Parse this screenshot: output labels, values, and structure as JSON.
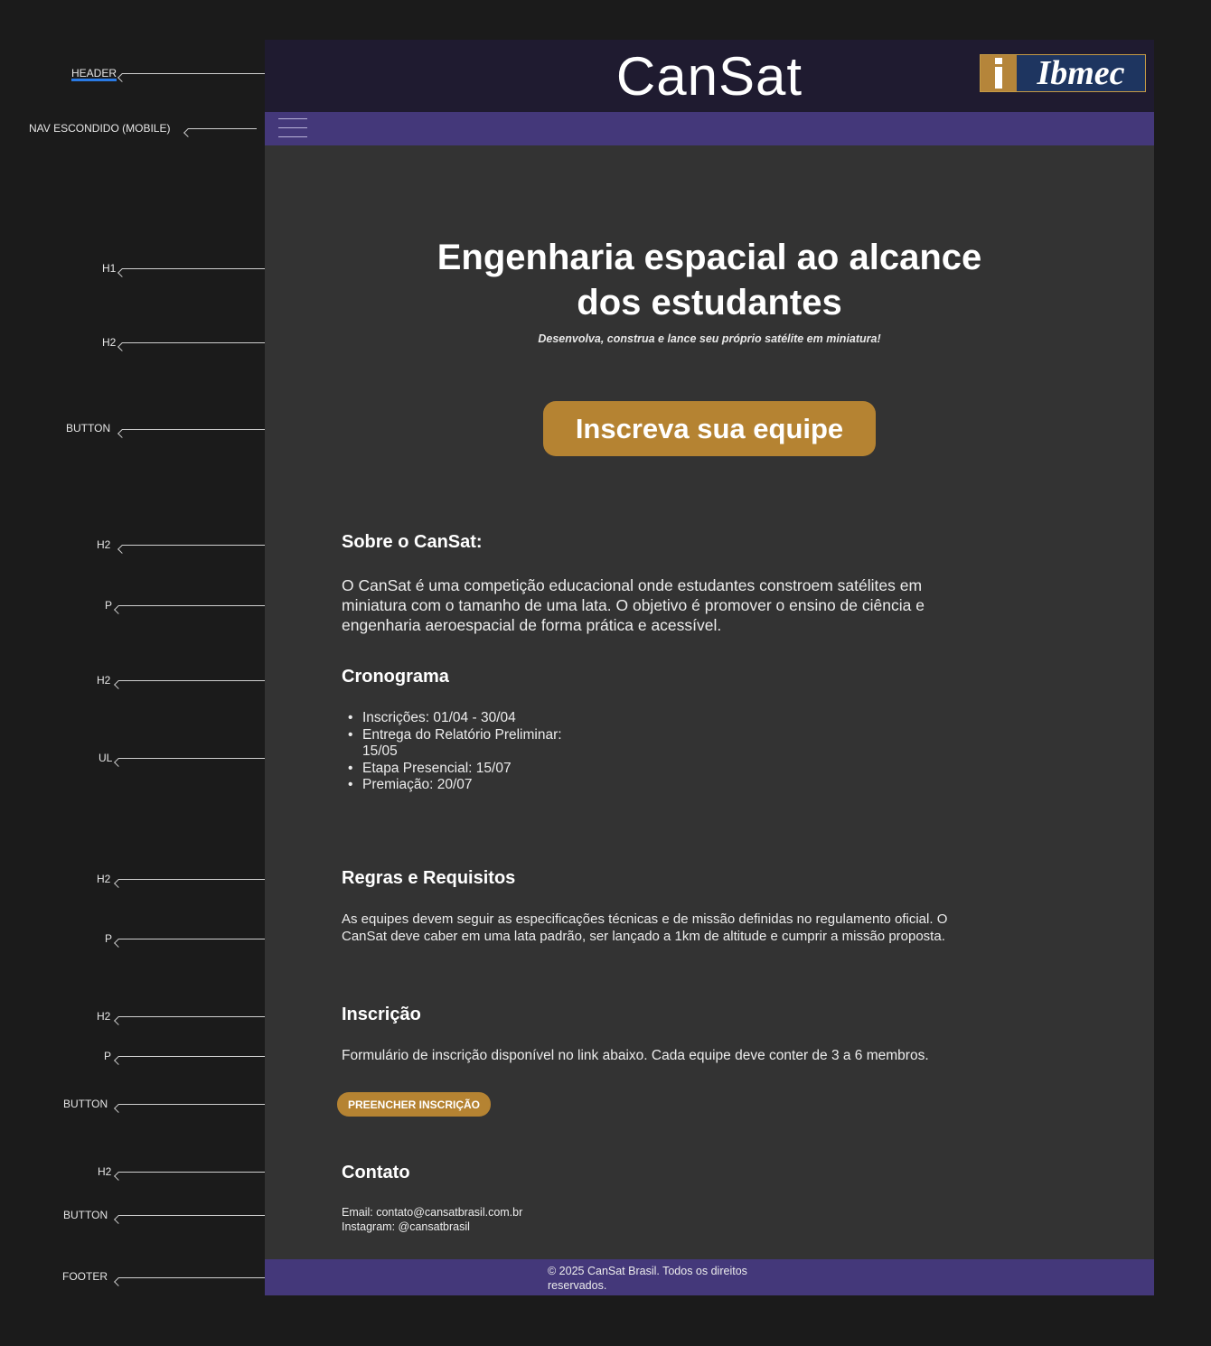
{
  "header": {
    "title": "CanSat",
    "logo_text": "Ibmec"
  },
  "hero": {
    "title": "Engenharia espacial ao alcance dos estudantes",
    "subtitle": "Desenvolva, construa e lance seu próprio satélite em miniatura!",
    "cta_label": "Inscreva sua equipe"
  },
  "about": {
    "heading": "Sobre o CanSat:",
    "text": "O CanSat é uma competição educacional onde estudantes constroem satélites em miniatura com o tamanho de uma lata. O objetivo é promover o ensino de ciência e engenharia aeroespacial de forma prática e acessível."
  },
  "schedule": {
    "heading": "Cronograma",
    "items": [
      "Inscrições: 01/04 - 30/04",
      "Entrega do Relatório Preliminar: 15/05",
      "Etapa Presencial: 15/07",
      "Premiação: 20/07"
    ]
  },
  "rules": {
    "heading": "Regras e Requisitos",
    "text": "As equipes devem seguir as especificações técnicas e de missão definidas no regulamento oficial. O CanSat deve caber em uma lata padrão, ser lançado a 1km de altitude e cumprir a missão proposta."
  },
  "registration": {
    "heading": "Inscrição",
    "text": "Formulário de inscrição disponível no link abaixo. Cada equipe deve conter de 3 a 6 membros.",
    "button_label": "PREENCHER INSCRIÇÃO"
  },
  "contact": {
    "heading": "Contato",
    "email": "Email: contato@cansatbrasil.com.br",
    "instagram": "Instagram: @cansatbrasil"
  },
  "footer": {
    "text": "© 2025 CanSat Brasil. Todos os direitos reservados."
  },
  "annotations": {
    "header": "HEADER",
    "nav": "NAV ESCONDIDO (MOBILE)",
    "h1": "H1",
    "h2": "H2",
    "button": "BUTTON",
    "p": "P",
    "ul": "UL",
    "footer": "FOOTER"
  },
  "colors": {
    "page_background": "#1b1b1b",
    "content_background": "#333333",
    "header_background": "#1f1b30",
    "nav_background": "#44387a",
    "accent": "#b58332"
  },
  "icons": {
    "menu": "hamburger-menu-icon",
    "annotation_arrow": "arrow-left-icon"
  }
}
